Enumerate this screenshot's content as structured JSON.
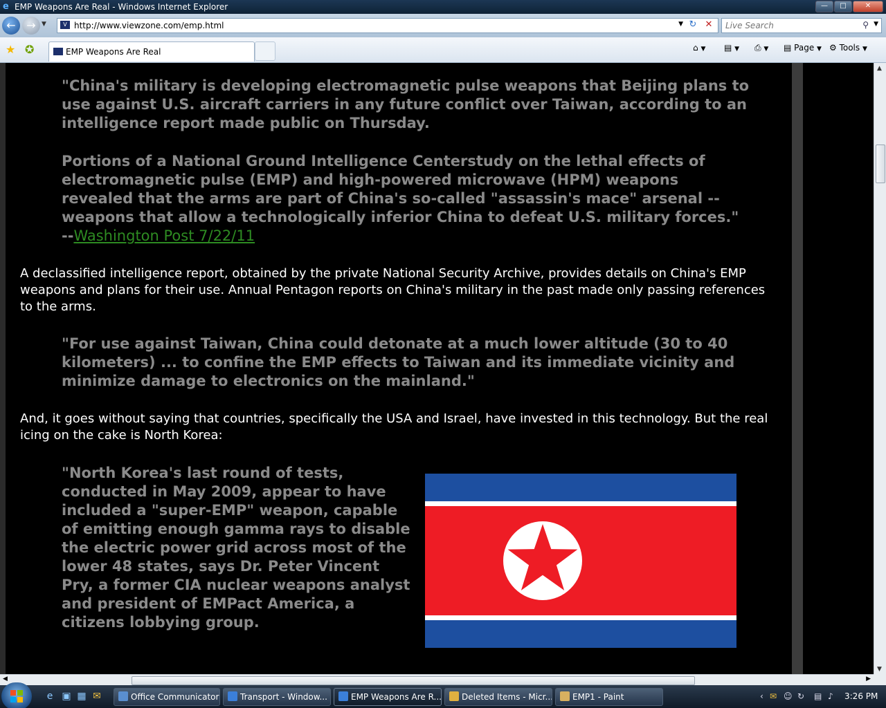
{
  "window": {
    "title": "EMP Weapons Are Real - Windows Internet Explorer",
    "controls": [
      "minimize",
      "maximize",
      "close"
    ]
  },
  "address_bar": {
    "url": "http://www.viewzone.com/emp.html"
  },
  "search": {
    "placeholder": "Live Search"
  },
  "tab": {
    "label": "EMP Weapons Are Real"
  },
  "command_bar": {
    "page_label": "Page",
    "tools_label": "Tools"
  },
  "content": {
    "quote1": "\"China's military is developing electromagnetic pulse weapons that Beijing plans to use against U.S. aircraft carriers in any future conflict over Taiwan, according to an intelligence report made public on Thursday.",
    "quote2_text": "Portions of a National Ground Intelligence Centerstudy on the lethal effects of electromagnetic pulse (EMP) and high-powered microwave (HPM) weapons revealed that the arms are part of China's so-called \"assassin's mace\" arsenal -- weapons that allow a technologically inferior China to defeat U.S. military forces.\" --",
    "quote2_link": "Washington Post 7/22/11",
    "para1": "A declassified intelligence report, obtained by the private National Security Archive, provides details on China's EMP weapons and plans for their use. Annual Pentagon reports on China's military in the past made only passing references to the arms.",
    "quote3": "\"For use against Taiwan, China could detonate at a much lower altitude (30 to 40 kilometers) ... to confine the EMP effects to Taiwan and its immediate vicinity and minimize damage to electronics on the mainland.\"",
    "para2": "And, it goes without saying that countries, specifically the USA and Israel, have invested in this technology. But the real icing on the cake is North Korea:",
    "quote4": "\"North Korea's last round of tests, conducted in May 2009, appear to have included a \"super-EMP\" weapon, capable of emitting enough gamma rays to disable the electric power grid across most of the lower 48 states, says Dr. Peter Vincent Pry, a former CIA nuclear weapons analyst and president of EMPact America, a citizens lobbying group."
  },
  "colors": {
    "quote_text": "#8a8a8a",
    "link": "#2e8b22",
    "flag_blue": "#1d4fa0",
    "flag_red": "#ee1c25"
  },
  "taskbar": {
    "items": [
      {
        "label": "Office Communicator",
        "active": false
      },
      {
        "label": "Transport - Window...",
        "active": false
      },
      {
        "label": "EMP Weapons Are R...",
        "active": true
      },
      {
        "label": "Deleted Items - Micr...",
        "active": false
      },
      {
        "label": "EMP1 - Paint",
        "active": false
      }
    ],
    "clock": "3:26 PM"
  }
}
